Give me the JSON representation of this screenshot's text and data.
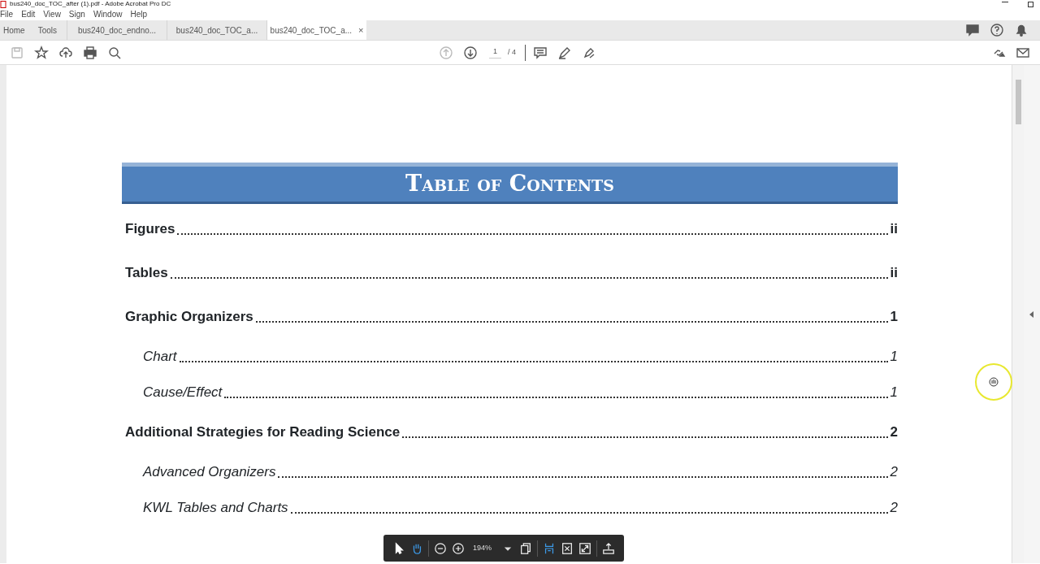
{
  "window": {
    "title": "bus240_doc_TOC_after (1).pdf - Adobe Acrobat Pro DC"
  },
  "menu": [
    "File",
    "Edit",
    "View",
    "Sign",
    "Window",
    "Help"
  ],
  "tabs": [
    {
      "label": "Home",
      "selected": false,
      "kind": "nav"
    },
    {
      "label": "Tools",
      "selected": false,
      "kind": "nav"
    },
    {
      "label": "bus240_doc_endno...",
      "selected": false,
      "kind": "doc"
    },
    {
      "label": "bus240_doc_TOC_a...",
      "selected": false,
      "kind": "doc"
    },
    {
      "label": "bus240_doc_TOC_a...",
      "selected": true,
      "kind": "doc",
      "close": "×"
    }
  ],
  "page_nav": {
    "current": "1",
    "total": "/ 4"
  },
  "zoom": "194%",
  "document": {
    "heading": "Table of Contents",
    "entries": [
      {
        "kind": "major",
        "title": "Figures",
        "page": "ii"
      },
      {
        "kind": "major",
        "title": "Tables",
        "page": "ii"
      },
      {
        "kind": "major",
        "title": "Graphic Organizers",
        "page": "1"
      },
      {
        "kind": "minor",
        "title": "Chart",
        "page": "1"
      },
      {
        "kind": "minor",
        "title": "Cause/Effect",
        "page": "1"
      },
      {
        "kind": "major",
        "title": "Additional Strategies for Reading Science",
        "page": "2"
      },
      {
        "kind": "minor",
        "title": "Advanced Organizers",
        "page": "2"
      },
      {
        "kind": "minor",
        "title": "KWL Tables and Charts",
        "page": "2"
      }
    ]
  }
}
